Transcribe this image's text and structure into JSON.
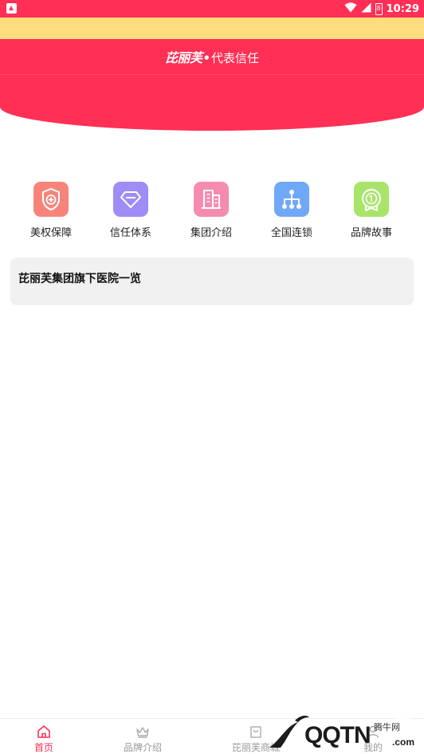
{
  "status_bar": {
    "time": "10:29",
    "battery": "8",
    "icons": [
      "app-notification-icon",
      "wifi-icon",
      "signal-icon",
      "battery-icon"
    ]
  },
  "header": {
    "brand_logo": "芘丽芙",
    "separator": "•",
    "slogan": "代表信任"
  },
  "quick_menu": [
    {
      "label": "美权保障",
      "icon": "shield-plus-icon",
      "color": "#f7847b"
    },
    {
      "label": "信任体系",
      "icon": "diamond-icon",
      "color": "#9f8cf7"
    },
    {
      "label": "集团介绍",
      "icon": "building-icon",
      "color": "#f68bb0"
    },
    {
      "label": "全国连锁",
      "icon": "network-icon",
      "color": "#6fa8f7"
    },
    {
      "label": "品牌故事",
      "icon": "medal-icon",
      "color": "#a8e46a"
    }
  ],
  "hospital_card": {
    "title": "芘丽芙集团旗下医院一览"
  },
  "bottom_nav": [
    {
      "label": "首页",
      "icon": "home-icon",
      "active": true
    },
    {
      "label": "品牌介绍",
      "icon": "crown-icon",
      "active": false
    },
    {
      "label": "芘丽芙商城",
      "icon": "mall-icon",
      "active": false
    },
    {
      "label": "我的",
      "icon": "user-icon",
      "active": false
    }
  ],
  "watermark": {
    "site": "腾牛网",
    "logo": "QQTN",
    "domain": ".com"
  },
  "colors": {
    "primary": "#ff2f55",
    "notice_band": "#ffdd7e",
    "card_bg": "#f1f1f1",
    "nav_inactive": "#999999"
  }
}
